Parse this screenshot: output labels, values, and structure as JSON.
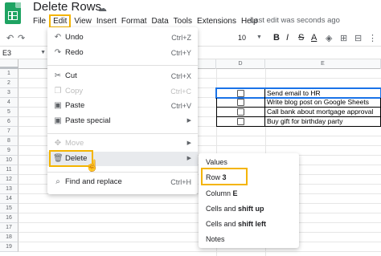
{
  "document": {
    "title": "Delete Rows",
    "last_edit": "Last edit was seconds ago"
  },
  "menubar": [
    "File",
    "Edit",
    "View",
    "Insert",
    "Format",
    "Data",
    "Tools",
    "Extensions",
    "Help"
  ],
  "toolbar": {
    "font_size": "10"
  },
  "namebox": {
    "value": "E3"
  },
  "columns": [
    "D",
    "E"
  ],
  "rows": [
    "1",
    "2",
    "3",
    "4",
    "5",
    "6",
    "7",
    "8",
    "9",
    "10",
    "11",
    "12",
    "13",
    "14",
    "15",
    "16",
    "17",
    "18",
    "19"
  ],
  "checklist": [
    "Send email to HR",
    "Write blog post on Google Sheets",
    "Call bank about mortgage approval",
    "Buy gift for birthday party"
  ],
  "edit_menu": {
    "undo": {
      "label": "Undo",
      "shortcut": "Ctrl+Z",
      "icon": "undo-icon"
    },
    "redo": {
      "label": "Redo",
      "shortcut": "Ctrl+Y",
      "icon": "redo-icon"
    },
    "cut": {
      "label": "Cut",
      "shortcut": "Ctrl+X",
      "icon": "scissors-icon"
    },
    "copy": {
      "label": "Copy",
      "shortcut": "Ctrl+C",
      "icon": "copy-icon"
    },
    "paste": {
      "label": "Paste",
      "shortcut": "Ctrl+V",
      "icon": "clipboard-icon"
    },
    "paste_special": {
      "label": "Paste special",
      "icon": "clipboard-icon"
    },
    "move": {
      "label": "Move",
      "icon": "move-icon"
    },
    "delete": {
      "label": "Delete",
      "icon": "trash-icon"
    },
    "find_replace": {
      "label": "Find and replace",
      "shortcut": "Ctrl+H",
      "icon": "search-icon"
    }
  },
  "delete_submenu": {
    "values": "Values",
    "row_prefix": "Row",
    "row_value": "3",
    "column_prefix": "Column",
    "column_value": "E",
    "cells_shift_up_prefix": "Cells and",
    "cells_shift_up_bold": "shift up",
    "cells_shift_left_prefix": "Cells and",
    "cells_shift_left_bold": "shift left",
    "notes": "Notes"
  },
  "colors": {
    "highlight": "#f4b400",
    "selection": "#1a73e8",
    "sheets_green": "#1ea362"
  }
}
